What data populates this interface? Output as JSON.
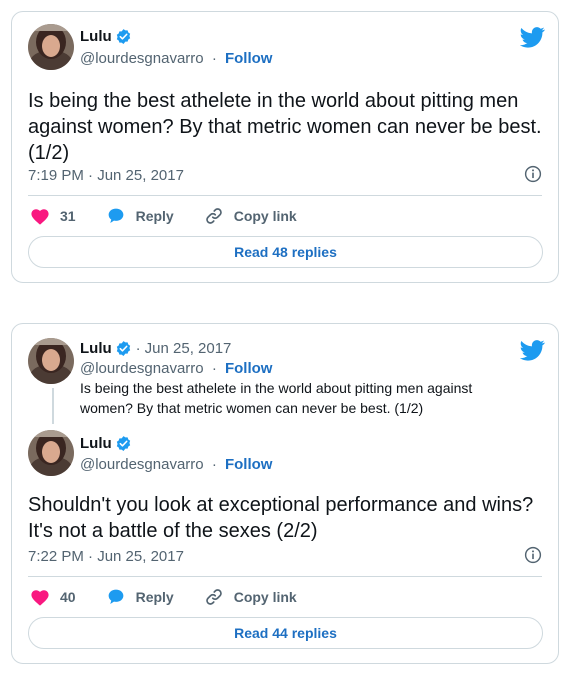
{
  "tweet1": {
    "name": "Lulu",
    "handle": "@lourdesgnavarro",
    "dot": "·",
    "follow": "Follow",
    "text": "Is being the best athelete in the world about pitting men against women? By that metric women can never be best. (1/2)",
    "timestamp": "7:19 PM · Jun 25, 2017",
    "likes": "31",
    "reply": "Reply",
    "copy_link": "Copy link",
    "read_replies": "Read 48 replies"
  },
  "tweet2": {
    "quoted": {
      "name": "Lulu",
      "date": "Jun 25, 2017",
      "handle": "@lourdesgnavarro",
      "follow": "Follow",
      "text": "Is being the best athelete in the world about pitting men against women? By that metric women can never be best. (1/2)"
    },
    "name": "Lulu",
    "handle": "@lourdesgnavarro",
    "dot": "·",
    "follow": "Follow",
    "text": "Shouldn't you look at exceptional performance and wins? It's not a battle of the sexes (2/2)",
    "timestamp": "7:22 PM · Jun 25, 2017",
    "likes": "40",
    "reply": "Reply",
    "copy_link": "Copy link",
    "read_replies": "Read 44 replies"
  },
  "colors": {
    "accent": "#1d9bf0",
    "link": "#1d6fc2",
    "like": "#f91880",
    "muted": "#536471",
    "border": "#cfd9de"
  },
  "icons": [
    "verified-badge-icon",
    "twitter-bird-icon",
    "info-icon",
    "heart-icon",
    "reply-bubble-icon",
    "link-icon"
  ]
}
